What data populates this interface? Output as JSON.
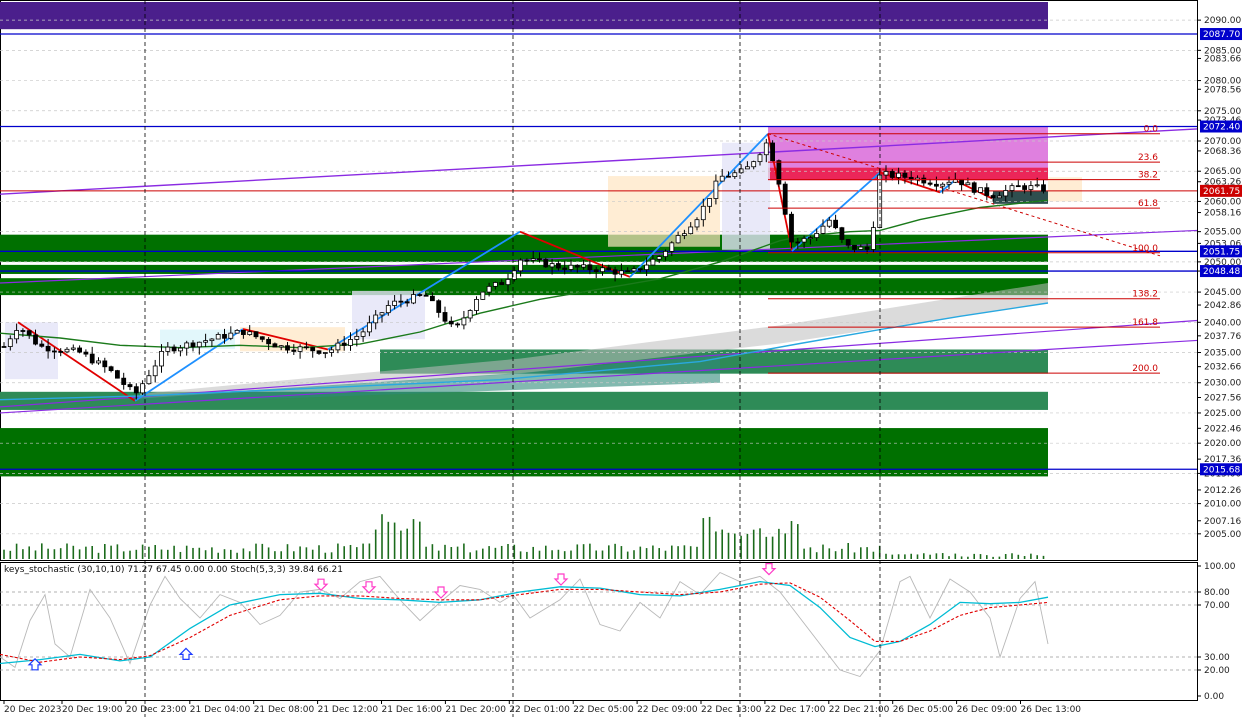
{
  "header": {
    "icons": [
      "list-icon",
      "chart-icon"
    ],
    "symbol_text": ""
  },
  "colors": {
    "bull": "#ffffff",
    "bear": "#000000",
    "ma_fast": "#1b7a1b",
    "ma_slow": "#29a8e0",
    "zigzag_up": "#1e90ff",
    "zigzag_down": "#e00000",
    "channel": "#8a2be2",
    "fib": "#cc0000",
    "level_blue": "#0000cc",
    "zone_green": "#007000",
    "zone_top": "#4b1f8c",
    "stoch_main": "#00bcd4",
    "stoch_signal": "#e00000",
    "stoch_raw": "#b8b8b8",
    "arrow_up": "#1e3cff",
    "arrow_down": "#ff3cc8"
  },
  "chart_data": {
    "type": "candlestick",
    "price_axis": {
      "ylim": [
        2001,
        2093
      ],
      "ticks": [
        "2090.00",
        "2085.00",
        "2083.66",
        "2080.00",
        "2078.56",
        "2075.00",
        "2073.46",
        "2070.00",
        "2068.36",
        "2065.00",
        "2063.26",
        "2060.00",
        "2058.16",
        "2055.00",
        "2053.06",
        "2050.00",
        "2048.48",
        "2045.00",
        "2042.86",
        "2040.00",
        "2037.76",
        "2035.00",
        "2032.66",
        "2030.00",
        "2027.56",
        "2025.00",
        "2022.46",
        "2020.00",
        "2017.36",
        "2015.00",
        "2012.26",
        "2010.00",
        "2007.16",
        "2005.00"
      ]
    },
    "price_tags": [
      {
        "value": 2087.7,
        "label": "2087.70"
      },
      {
        "value": 2072.4,
        "label": "2072.40"
      },
      {
        "value": 2061.75,
        "label": "2061.75"
      },
      {
        "value": 2051.75,
        "label": "2051.75"
      },
      {
        "value": 2048.48,
        "label": "2048.48"
      },
      {
        "value": 2015.68,
        "label": "2015.68"
      }
    ],
    "time_labels": [
      "20 Dec 2023",
      "20 Dec 19:00",
      "20 Dec 23:00",
      "21 Dec 04:00",
      "21 Dec 08:00",
      "21 Dec 12:00",
      "21 Dec 16:00",
      "21 Dec 20:00",
      "22 Dec 01:00",
      "22 Dec 05:00",
      "22 Dec 09:00",
      "22 Dec 13:00",
      "22 Dec 17:00",
      "22 Dec 21:00",
      "26 Dec 05:00",
      "26 Dec 09:00",
      "26 Dec 13:00"
    ],
    "fib_levels": [
      {
        "label": "0.0",
        "value": 2071.2
      },
      {
        "label": "23.6",
        "value": 2066.5
      },
      {
        "label": "38.2",
        "value": 2063.6
      },
      {
        "label": "61.8",
        "value": 2058.9
      },
      {
        "label": "100.0",
        "value": 2051.5
      },
      {
        "label": "138.2",
        "value": 2043.9
      },
      {
        "label": "161.8",
        "value": 2039.2
      },
      {
        "label": "200.0",
        "value": 2031.6
      }
    ],
    "stochastic": {
      "label": "keys_stochastic (30,10,10) 71.27 67.45 0.00 0.00 Stoch(5,3,3) 39.84 66.21",
      "ylim": [
        0,
        100
      ],
      "ticks": [
        "100.00",
        "80.00",
        "70.00",
        "30.00",
        "20.00",
        "0.00"
      ]
    }
  }
}
